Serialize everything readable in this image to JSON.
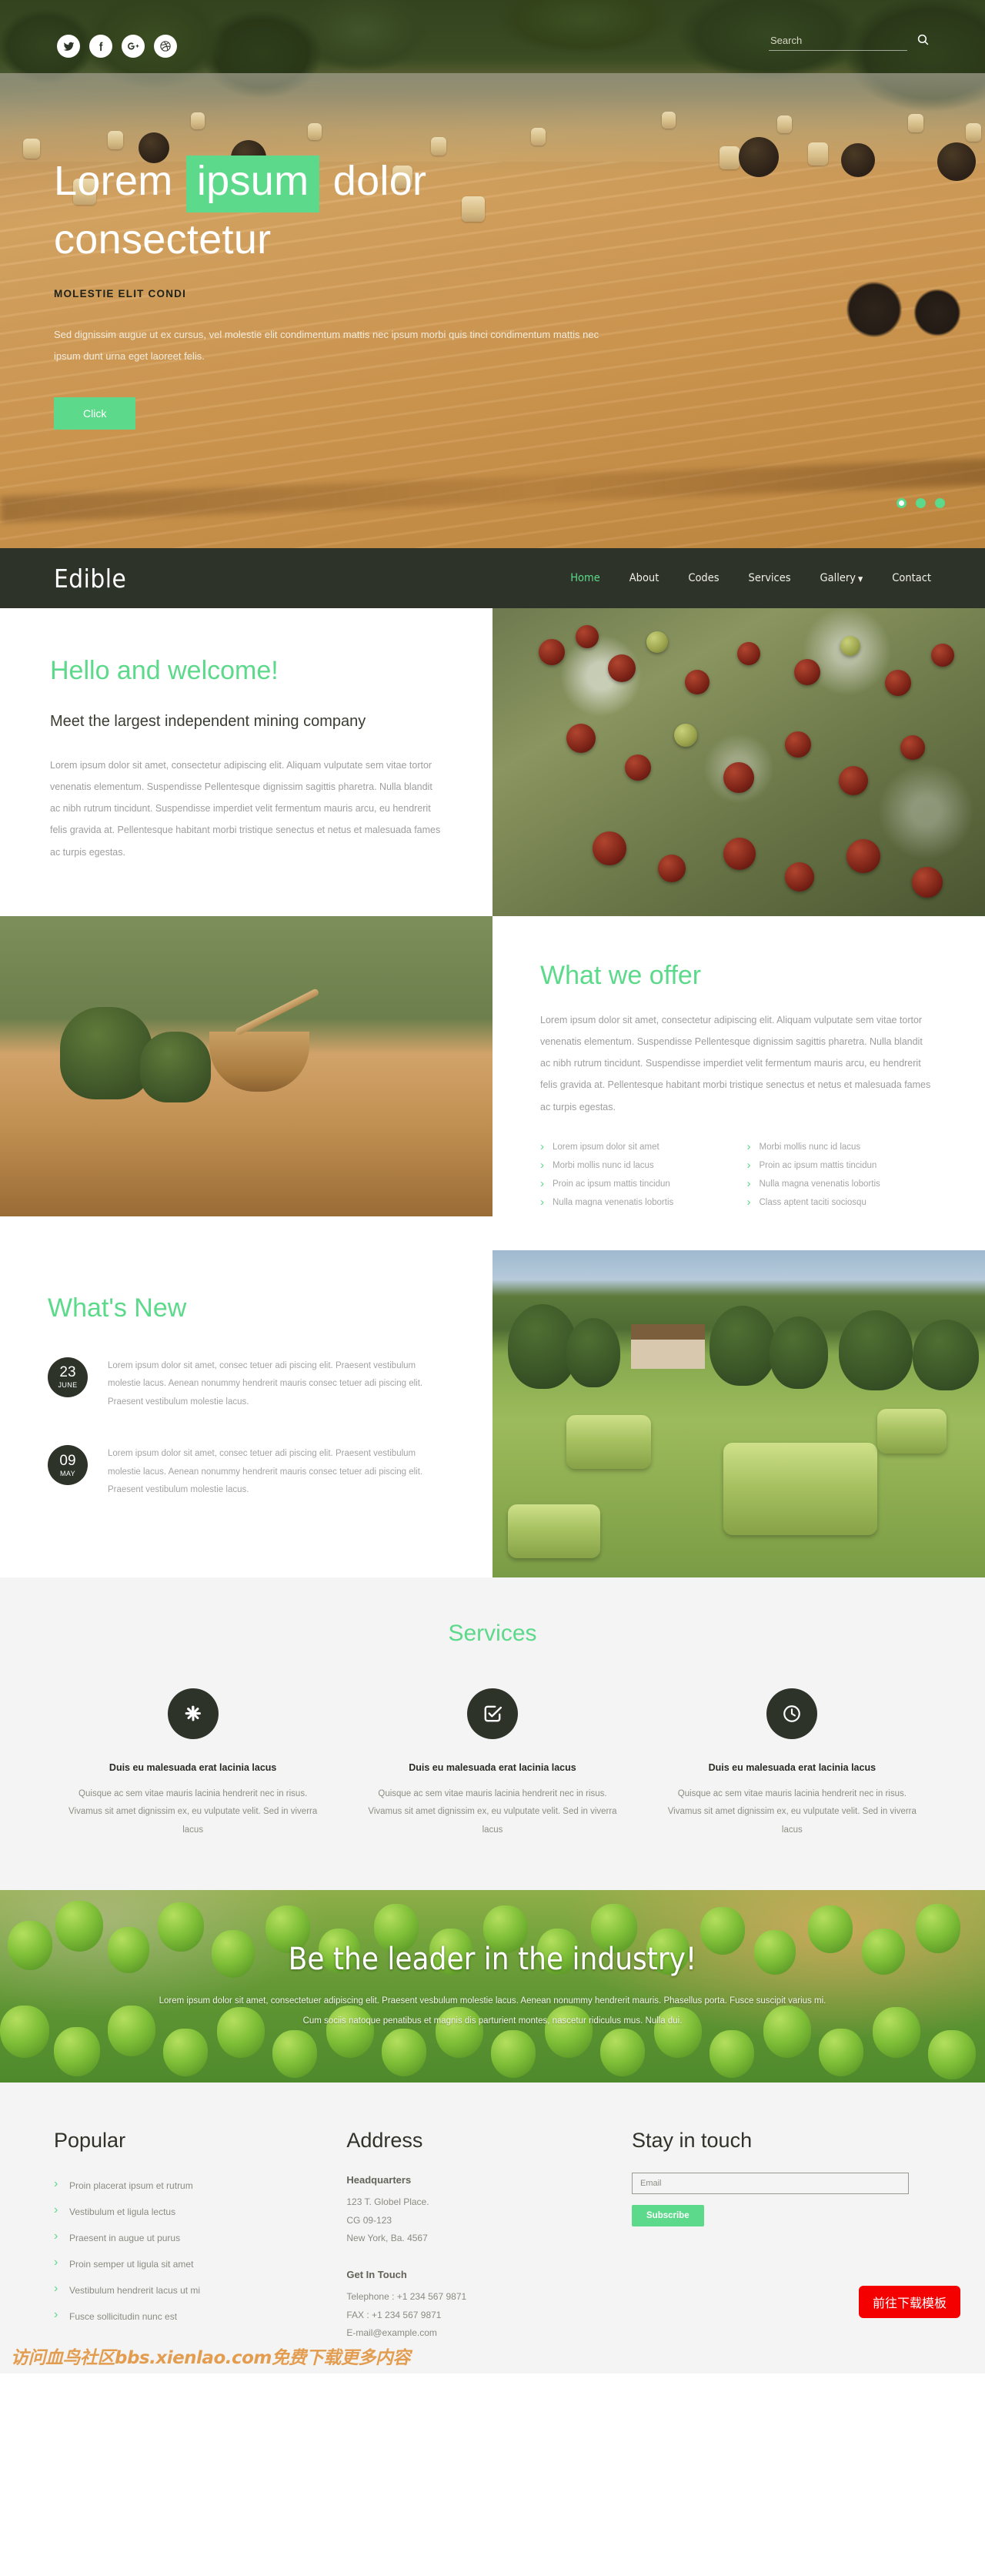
{
  "colors": {
    "accent_green": "#5cd98a",
    "dark": "#2d3328",
    "muted_text": "#9d9d9d",
    "panel_bg": "#f4f4f4",
    "download_red": "#f50000"
  },
  "topbar": {
    "social": [
      {
        "name": "twitter",
        "glyph": "twitter-icon"
      },
      {
        "name": "facebook",
        "glyph": "facebook-icon"
      },
      {
        "name": "google-plus",
        "glyph": "google-plus-icon"
      },
      {
        "name": "dribbble",
        "glyph": "dribbble-icon"
      }
    ],
    "search_placeholder": "Search",
    "search_value": ""
  },
  "hero": {
    "title_part1": "Lorem",
    "title_highlight": "ipsum",
    "title_part2": "dolor",
    "title_line2": "consectetur",
    "subtitle": "MOLESTIE ELIT CONDI",
    "paragraph": "Sed dignissim augue ut ex cursus, vel molestie elit condimentum mattis nec ipsum morbi quis tinci condimentum mattis nec ipsum dunt urna eget laoreet felis.",
    "button": "Click",
    "slides": 3,
    "active_slide": 1
  },
  "nav": {
    "brand": "Edible",
    "items": [
      {
        "label": "Home",
        "active": true
      },
      {
        "label": "About",
        "active": false
      },
      {
        "label": "Codes",
        "active": false
      },
      {
        "label": "Services",
        "active": false
      },
      {
        "label": "Gallery",
        "active": false,
        "has_dropdown": true
      },
      {
        "label": "Contact",
        "active": false
      }
    ]
  },
  "welcome": {
    "heading": "Hello and welcome!",
    "subheading": "Meet the largest independent mining company",
    "paragraph": "Lorem ipsum dolor sit amet, consectetur adipiscing elit. Aliquam vulputate sem vitae tortor venenatis elementum. Suspendisse Pellentesque dignissim sagittis pharetra. Nulla blandit ac nibh rutrum tincidunt. Suspendisse imperdiet velit fermentum mauris arcu, eu hendrerit felis gravida at. Pellentesque habitant morbi tristique senectus et netus et malesuada fames ac turpis egestas."
  },
  "offer": {
    "heading": "What we offer",
    "paragraph": "Lorem ipsum dolor sit amet, consectetur adipiscing elit. Aliquam vulputate sem vitae tortor venenatis elementum. Suspendisse Pellentesque dignissim sagittis pharetra. Nulla blandit ac nibh rutrum tincidunt. Suspendisse imperdiet velit fermentum mauris arcu, eu hendrerit felis gravida at. Pellentesque habitant morbi tristique senectus et netus et malesuada fames ac turpis egestas.",
    "list_left": [
      "Lorem ipsum dolor sit amet",
      "Morbi mollis nunc id lacus",
      "Proin ac ipsum mattis tincidun",
      "Nulla magna venenatis lobortis"
    ],
    "list_right": [
      "Morbi mollis nunc id lacus",
      "Proin ac ipsum mattis tincidun",
      "Nulla magna venenatis lobortis",
      "Class aptent taciti sociosqu"
    ]
  },
  "news": {
    "heading": "What's New",
    "items": [
      {
        "day": "23",
        "month": "JUNE",
        "text": "Lorem ipsum dolor sit amet, consec tetuer adi piscing elit. Praesent vestibulum molestie lacus. Aenean nonummy hendrerit mauris consec tetuer adi piscing elit. Praesent vestibulum molestie lacus."
      },
      {
        "day": "09",
        "month": "MAY",
        "text": "Lorem ipsum dolor sit amet, consec tetuer adi piscing elit. Praesent vestibulum molestie lacus. Aenean nonummy hendrerit mauris consec tetuer adi piscing elit. Praesent vestibulum molestie lacus."
      }
    ]
  },
  "services": {
    "heading": "Services",
    "items": [
      {
        "icon": "asterisk-icon",
        "title": "Duis eu malesuada erat lacinia lacus",
        "text": "Quisque ac sem vitae mauris lacinia hendrerit nec in risus. Vivamus sit amet dignissim ex, eu vulputate velit. Sed in viverra lacus"
      },
      {
        "icon": "check-square-icon",
        "title": "Duis eu malesuada erat lacinia lacus",
        "text": "Quisque ac sem vitae mauris lacinia hendrerit nec in risus. Vivamus sit amet dignissim ex, eu vulputate velit. Sed in viverra lacus"
      },
      {
        "icon": "clock-icon",
        "title": "Duis eu malesuada erat lacinia lacus",
        "text": "Quisque ac sem vitae mauris lacinia hendrerit nec in risus. Vivamus sit amet dignissim ex, eu vulputate velit. Sed in viverra lacus"
      }
    ]
  },
  "leader": {
    "heading": "Be the leader in the industry!",
    "paragraph": "Lorem ipsum dolor sit amet, consectetuer adipiscing elit. Praesent vesbulum molestie lacus. Aenean nonummy hendrerit mauris. Phasellus porta. Fusce suscipit varius mi. Cum sociis natoque penatibus et magnis dis parturient montes, nascetur ridiculus mus. Nulla dui."
  },
  "footer": {
    "popular": {
      "heading": "Popular",
      "links": [
        "Proin placerat ipsum et rutrum",
        "Vestibulum et ligula lectus",
        "Praesent in augue ut purus",
        "Proin semper ut ligula sit amet",
        "Vestibulum hendrerit lacus ut mi",
        "Fusce sollicitudin nunc est"
      ]
    },
    "address": {
      "heading": "Address",
      "hq_label": "Headquarters",
      "line1": "123 T. Globel Place.",
      "line2": "CG 09-123",
      "line3": "New York, Ba. 4567",
      "touch_label": "Get In Touch",
      "telephone": "Telephone : +1 234 567 9871",
      "fax": "FAX : +1 234 567 9871",
      "email": "E-mail@example.com"
    },
    "stay": {
      "heading": "Stay in touch",
      "email_placeholder": "Email",
      "email_value": "",
      "subscribe_label": "Subscribe"
    }
  },
  "overlay": {
    "watermark": "访问血鸟社区bbs.xienlao.com免费下载更多内容",
    "download_label": "前往下载模板"
  }
}
